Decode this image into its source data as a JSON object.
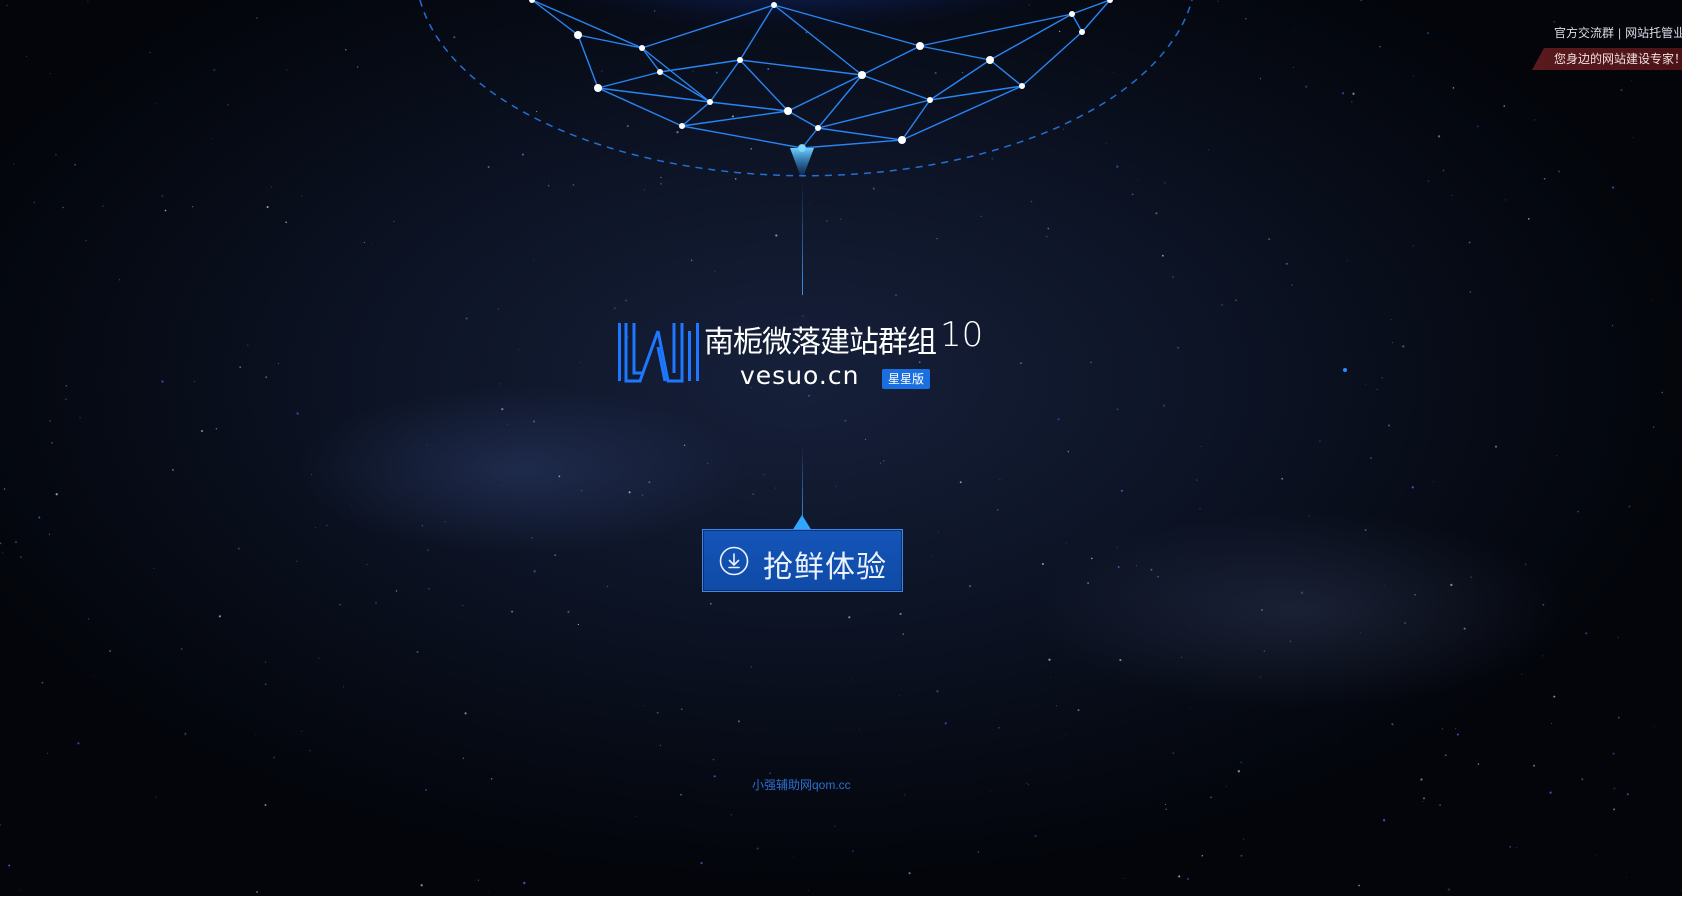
{
  "top_bar": {
    "link_group": "官方交流群",
    "separator": "|",
    "link_hosting": "网站托管业",
    "ribbon_text": "您身边的网站建设专家！"
  },
  "logo": {
    "title": "南栀微落建站群组",
    "version": "10",
    "domain": "vesuo.cn",
    "badge": "星星版"
  },
  "cta": {
    "label": "抢鲜体验",
    "icon": "download-circle-icon"
  },
  "footer": {
    "watermark": "小强辅助网qom.cc"
  },
  "colors": {
    "background": "#0a1020",
    "accent_blue": "#1a6fe0",
    "button_blue": "#1455b8",
    "globe_line": "#2a8cff",
    "ribbon": "#5a1a1e"
  }
}
